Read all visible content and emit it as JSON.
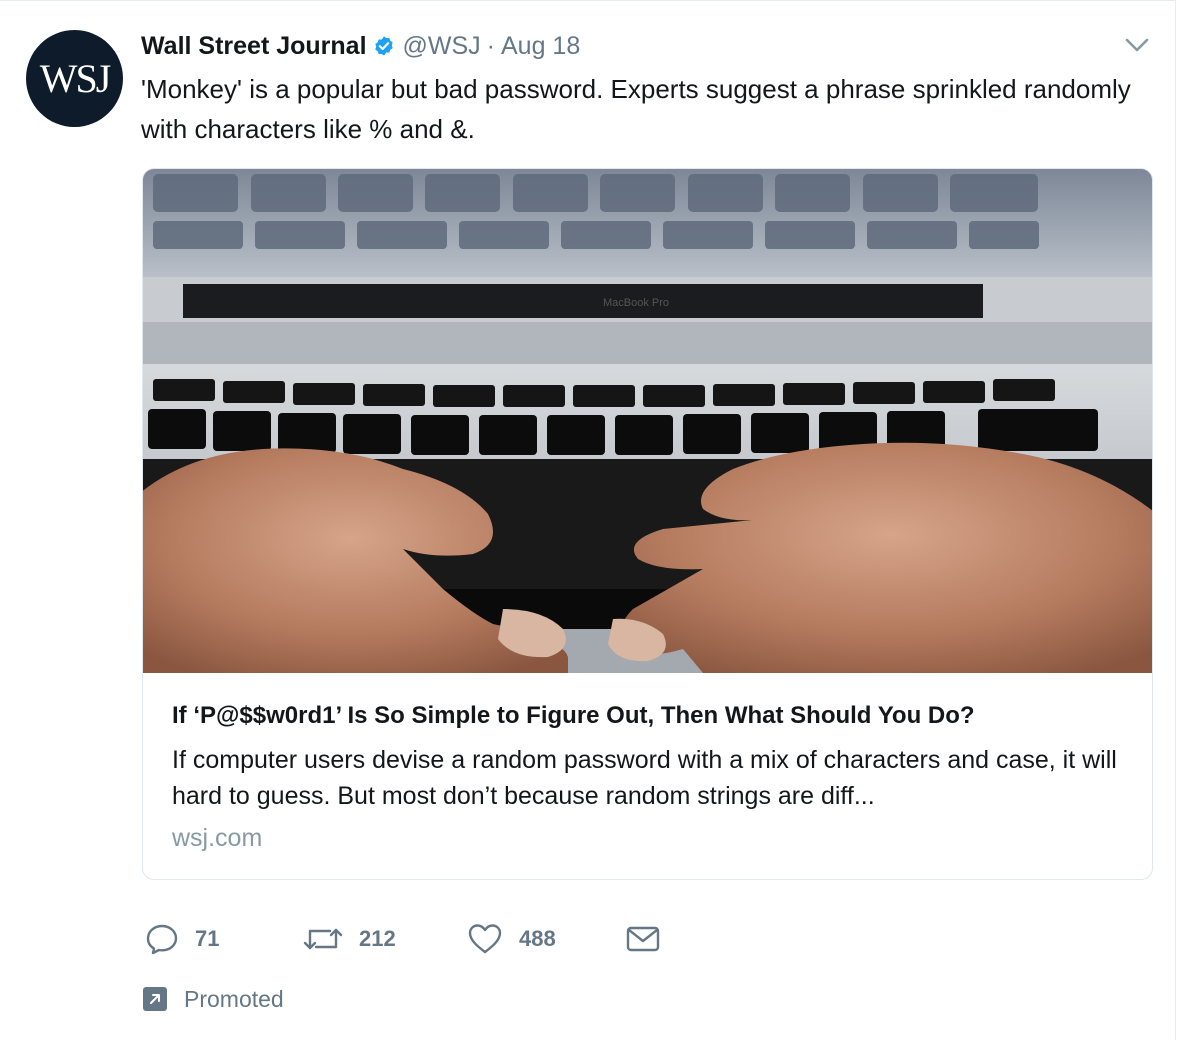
{
  "account": {
    "avatar_text": "WSJ",
    "name": "Wall Street Journal",
    "handle": "@WSJ",
    "separator": "·",
    "date": "Aug 18"
  },
  "tweet": {
    "text": "'Monkey' is a popular but bad password. Experts suggest a phrase sprinkled randomly with characters like % and &."
  },
  "card": {
    "image_icon": "laptop-keyboard-hands-photo",
    "image_caption": "MacBook Pro",
    "title": "If ‘P@$$w0rd1’ Is So Simple to Figure Out, Then What Should You Do?",
    "description": "If computer users devise a random password with a mix of characters and case, it will hard to guess. But most don’t because random strings are diff...",
    "domain": "wsj.com"
  },
  "actions": {
    "reply_count": "71",
    "retweet_count": "212",
    "like_count": "488"
  },
  "promoted": {
    "label": "Promoted"
  },
  "colors": {
    "text": "#14171a",
    "muted": "#657786",
    "verified": "#1da1f2",
    "avatar_bg": "#0e1b2b",
    "border": "#e1e8ed"
  }
}
